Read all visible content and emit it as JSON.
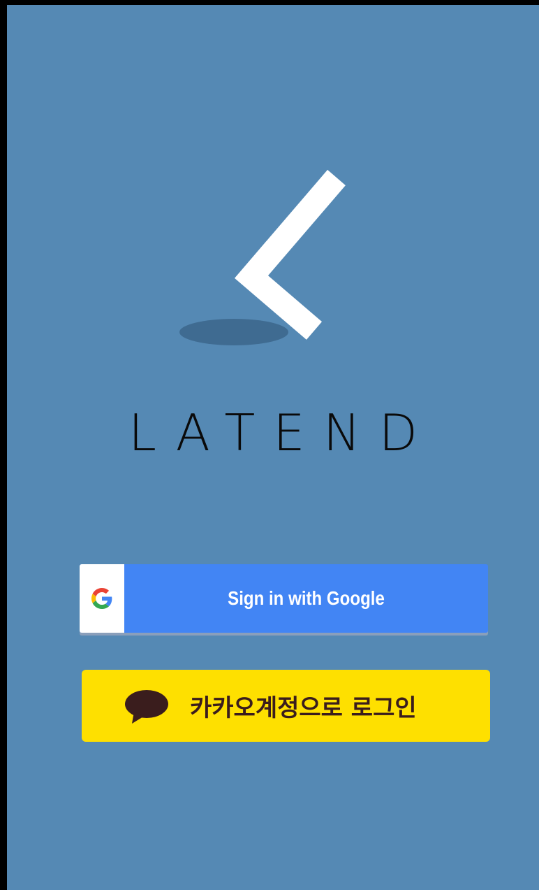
{
  "app": {
    "title": "LATEND"
  },
  "login": {
    "google_label": "Sign in with Google",
    "kakao_label": "카카오계정으로 로그인"
  },
  "colors": {
    "background": "#5589b4",
    "google_blue": "#4285f4",
    "kakao_yellow": "#fee000",
    "kakao_text": "#3a1d1d"
  },
  "icons": {
    "logo": "chevron-left-logo",
    "google": "google-g-icon",
    "kakao": "speech-bubble-icon"
  }
}
